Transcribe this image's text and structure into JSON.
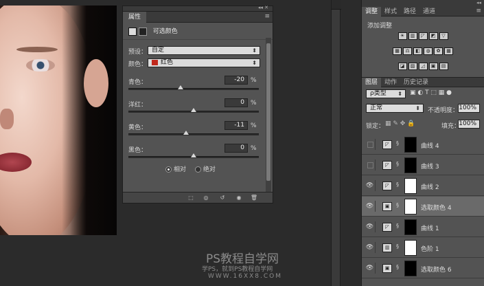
{
  "properties": {
    "title": "属性",
    "mode": "可选颜色",
    "preset_label": "预设：",
    "preset_value": "自定",
    "colors_label": "颜色：",
    "colors_value": "红色",
    "swatch": "#c0281c",
    "sliders": [
      {
        "label": "青色：",
        "value": "-20",
        "unit": "%",
        "pos": 0.4
      },
      {
        "label": "洋红：",
        "value": "0",
        "unit": "%",
        "pos": 0.5
      },
      {
        "label": "黄色：",
        "value": "-11",
        "unit": "%",
        "pos": 0.44
      },
      {
        "label": "黑色：",
        "value": "0",
        "unit": "%",
        "pos": 0.5
      }
    ],
    "relative": "相对",
    "absolute": "绝对"
  },
  "right": {
    "tabs": [
      "调整",
      "样式",
      "路径",
      "通道"
    ],
    "adjust_title": "添加调整",
    "layer_tabs": [
      "图层",
      "动作",
      "历史记录"
    ],
    "filter": "ρ类型",
    "blend": "正常",
    "opacity_label": "不透明度：",
    "opacity": "100%",
    "lock_label": "锁定：",
    "fill_label": "填充：",
    "fill": "100%",
    "layers": [
      {
        "name": "曲线 4"
      },
      {
        "name": "曲线 3"
      },
      {
        "name": "曲线 2"
      },
      {
        "name": "选取颜色 4"
      },
      {
        "name": "曲线 1"
      },
      {
        "name": "色阶 1"
      },
      {
        "name": "选取颜色 6"
      }
    ]
  },
  "watermark": {
    "line1": "PS教程自学网",
    "line2": "学PS，就到PS教程自学网",
    "line3": "WWW.16XX8.COM"
  }
}
